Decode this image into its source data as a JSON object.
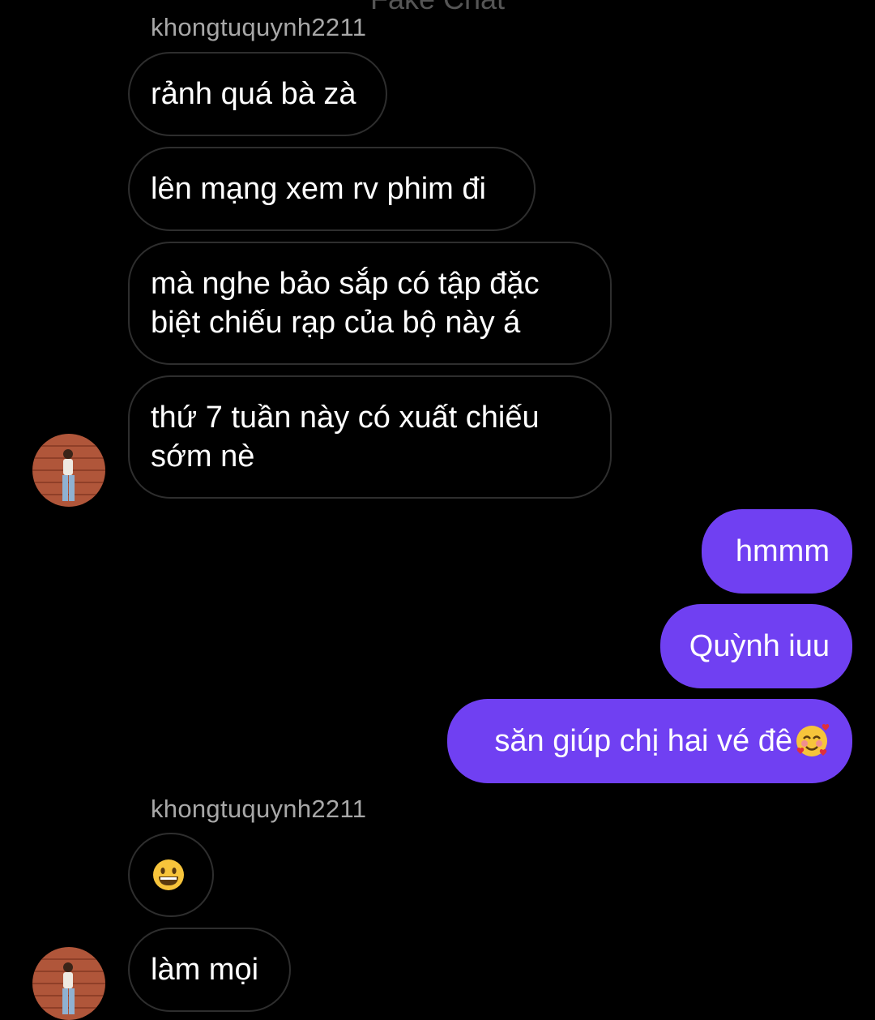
{
  "header": {
    "faded_title": "Fake Chat"
  },
  "thread": {
    "sender_name": "khongtuquynh2211",
    "group1": [
      "rảnh quá bà zà",
      "lên mạng xem rv phim đi",
      "mà nghe bảo sắp có tập đặc\nbiệt chiếu rạp của bộ này á",
      "thứ 7 tuần này có xuất chiếu\nsớm nè"
    ],
    "outgoing": [
      "hmmm",
      "Quỳnh iuu",
      "săn giúp chị hai vé đê"
    ],
    "outgoing_emoji": "smiling-face-with-hearts",
    "group2_sender_name": "khongtuquynh2211",
    "group2_emoji": "grinning-face",
    "group2_last": "làm mọi"
  },
  "colors": {
    "outgoing_bubble": "#7040f2",
    "incoming_border": "#2e2e2e",
    "sender_text": "#a8a8a8",
    "background": "#000000"
  }
}
